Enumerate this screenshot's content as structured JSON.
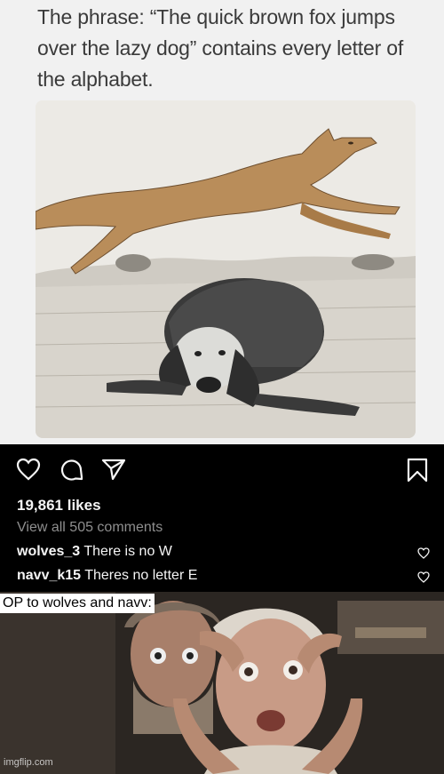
{
  "headline": "The phrase: “The quick brown fox jumps over the lazy dog” contains every letter of the alphabet.",
  "illustration": {
    "description_icons": [
      "fox-icon",
      "dog-icon"
    ],
    "colors": {
      "fox": "#b98d5a",
      "dog": "#3a3a3a",
      "ground": "#d6d2cb"
    }
  },
  "post": {
    "likes": "19,861 likes",
    "view_all": "View all 505 comments",
    "comments": [
      {
        "user": "wolves_3",
        "text": " There is no W"
      },
      {
        "user": "navv_k15",
        "text": " Theres no letter E"
      }
    ]
  },
  "meme": {
    "caption": "OP to wolves and navv:",
    "watermark": "imgflip.com",
    "colors": {
      "bg": "#2b2622",
      "skin": "#c89b86"
    }
  }
}
